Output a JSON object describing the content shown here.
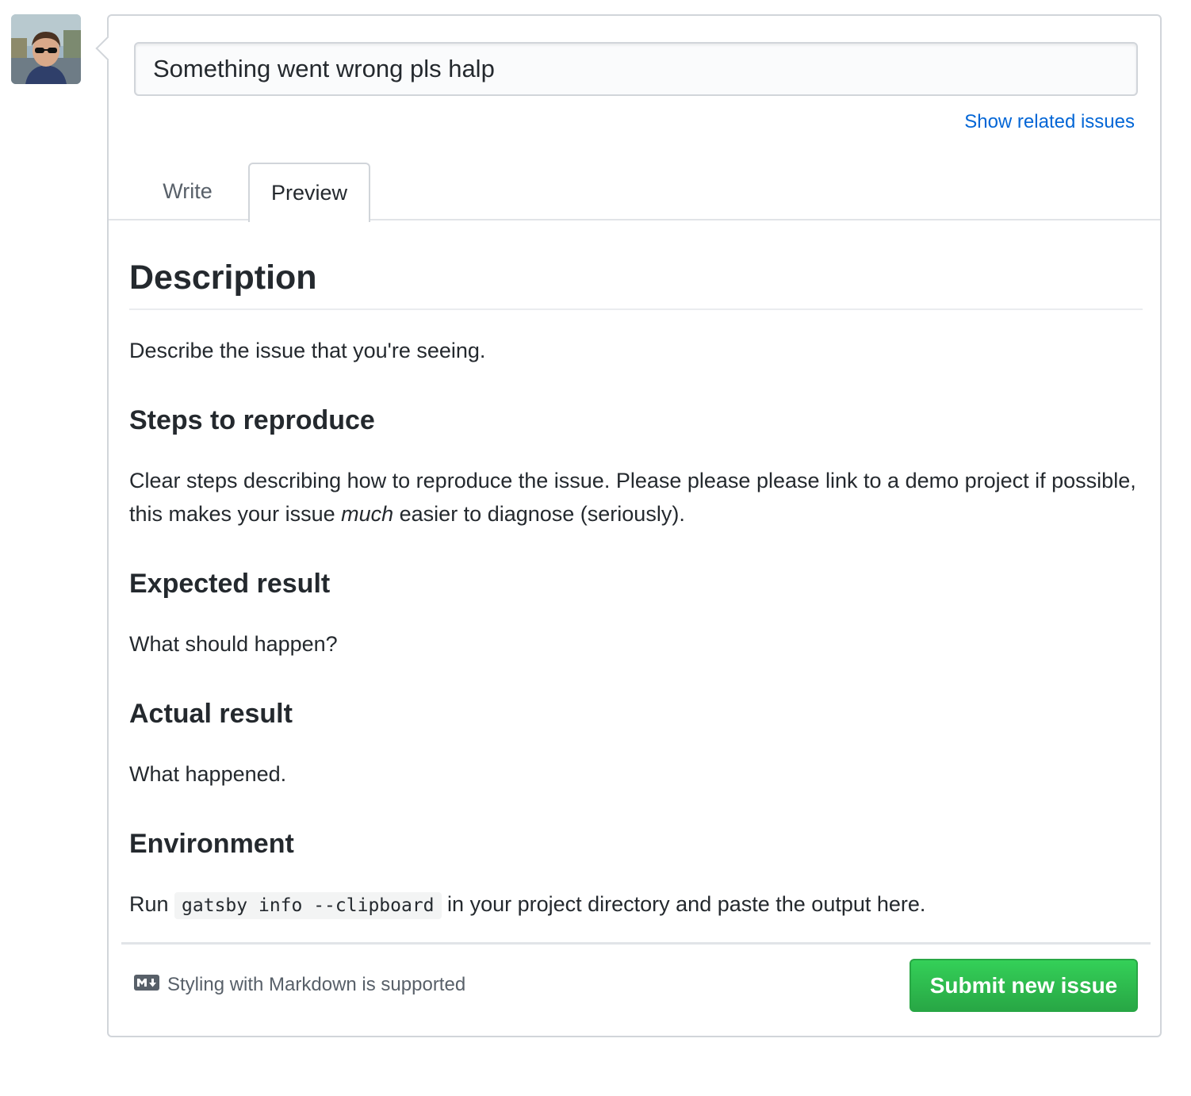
{
  "issue_form": {
    "title_value": "Something went wrong pls halp",
    "related_link": "Show related issues",
    "tabs": [
      {
        "label": "Write",
        "active": false
      },
      {
        "label": "Preview",
        "active": true
      }
    ]
  },
  "preview": {
    "heading": "Description",
    "description_text": "Describe the issue that you're seeing.",
    "sections": [
      {
        "heading": "Steps to reproduce"
      },
      {
        "heading": "Expected result",
        "text": "What should happen?"
      },
      {
        "heading": "Actual result",
        "text": "What happened."
      },
      {
        "heading": "Environment"
      }
    ],
    "steps_text_before": "Clear steps describing how to reproduce the issue. Please please please link to a demo project if possible, this makes your issue ",
    "steps_text_emphasis": "much",
    "steps_text_after": " easier to diagnose (seriously).",
    "env_text_before": "Run ",
    "env_code": "gatsby info --clipboard",
    "env_text_after": " in your project directory and paste the output here."
  },
  "footer": {
    "markdown_note": "Styling with Markdown is supported",
    "submit_label": "Submit new issue"
  },
  "colors": {
    "link": "#0366d6",
    "submit_green": "#28a745",
    "text": "#24292e",
    "muted": "#586069"
  },
  "icons": {
    "avatar": "user-avatar-photo",
    "markdown": "markdown-icon"
  }
}
